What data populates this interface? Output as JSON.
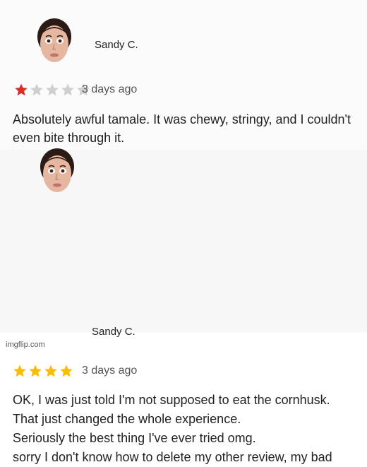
{
  "reviews": [
    {
      "reviewer": "Sandy C.",
      "rating": 1,
      "max_rating": 5,
      "time": "3 days ago",
      "text": "Absolutely awful tamale. It was chewy, stringy, and I couldn't even bite through it.",
      "star_color": "#d93025"
    },
    {
      "reviewer": "Sandy C.",
      "rating": 4,
      "max_rating": 4,
      "time": "3 days ago",
      "text_lines": [
        "OK, I was just told I'm not supposed to eat the cornhusk.",
        "That just changed the whole experience.",
        "Seriously the best thing I've ever tried omg.",
        "sorry I don't know how to delete my other review, my bad"
      ],
      "star_color": "#fbbc04"
    }
  ],
  "empty_star_color": "#cfcfcf",
  "footer": "imgflip.com"
}
